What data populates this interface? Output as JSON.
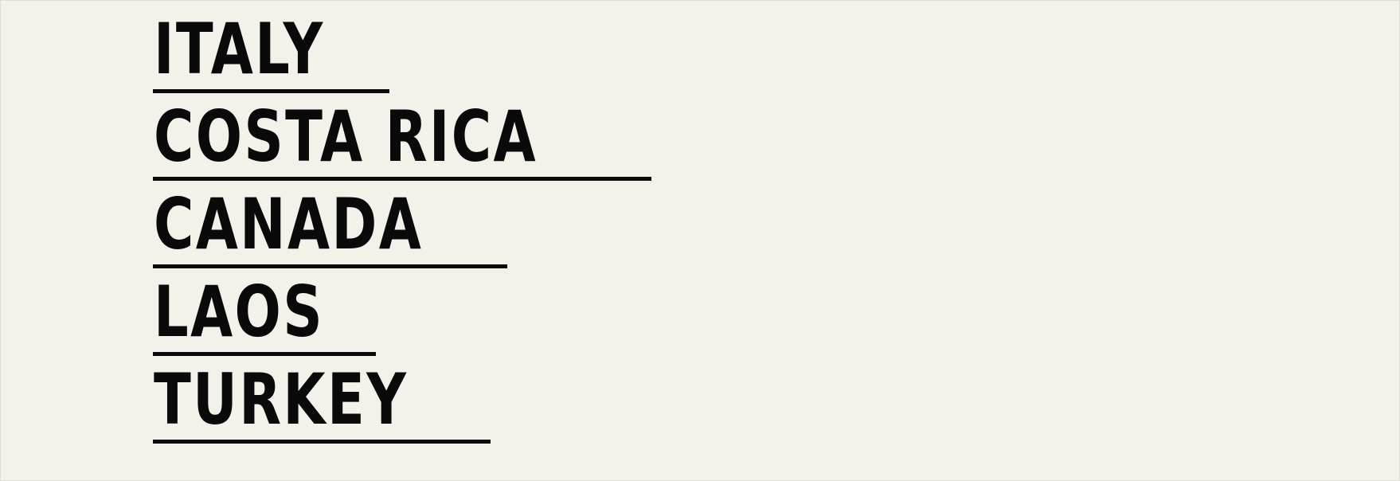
{
  "countries": [
    {
      "name": "ITALY"
    },
    {
      "name": "COSTA RICA"
    },
    {
      "name": "CANADA"
    },
    {
      "name": "LAOS"
    },
    {
      "name": "TURKEY"
    }
  ],
  "colors": {
    "background": "#f4f1ea",
    "text": "#0a0a0a",
    "underline": "#0a0a0a"
  }
}
